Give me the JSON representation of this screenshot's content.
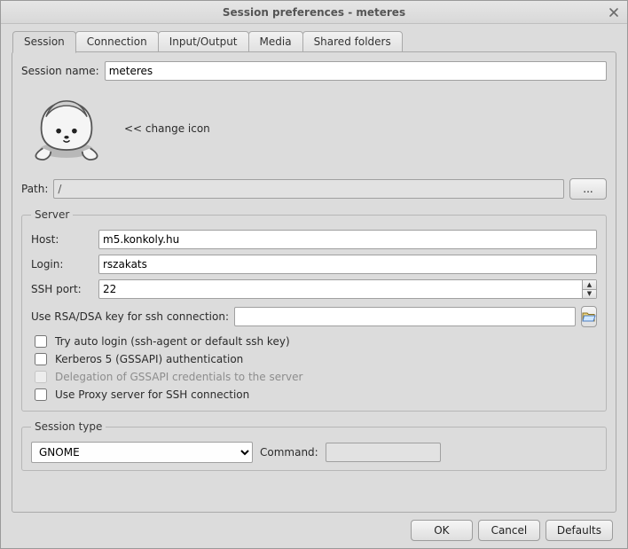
{
  "window": {
    "title": "Session preferences - meteres"
  },
  "tabs": {
    "session": "Session",
    "connection": "Connection",
    "io": "Input/Output",
    "media": "Media",
    "shared": "Shared folders"
  },
  "session": {
    "name_label": "Session name:",
    "name_value": "meteres",
    "change_icon": "<< change icon",
    "path_label": "Path:",
    "path_value": "/",
    "browse_label": "..."
  },
  "server": {
    "legend": "Server",
    "host_label": "Host:",
    "host_value": "m5.konkoly.hu",
    "login_label": "Login:",
    "login_value": "rszakats",
    "sshport_label": "SSH port:",
    "sshport_value": "22",
    "rsa_label": "Use RSA/DSA key for ssh connection:",
    "rsa_value": "",
    "auto_login": "Try auto login (ssh-agent or default ssh key)",
    "kerberos": "Kerberos 5 (GSSAPI) authentication",
    "delegation": "Delegation of GSSAPI credentials to the server",
    "proxy": "Use Proxy server for SSH connection"
  },
  "session_type": {
    "legend": "Session type",
    "selected": "GNOME",
    "command_label": "Command:",
    "command_value": ""
  },
  "footer": {
    "ok": "OK",
    "cancel": "Cancel",
    "defaults": "Defaults"
  }
}
